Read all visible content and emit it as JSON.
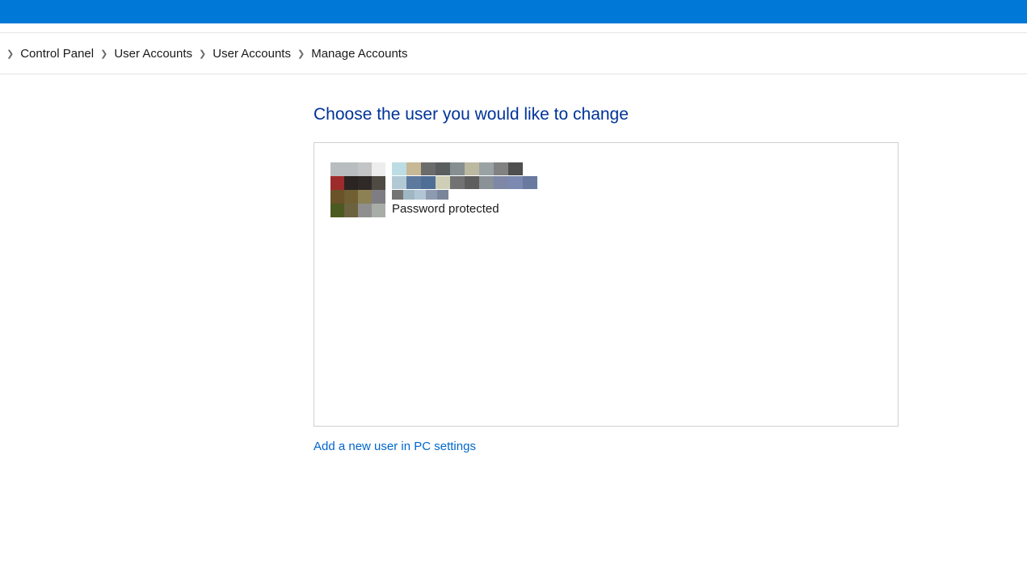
{
  "breadcrumb": {
    "items": [
      "Control Panel",
      "User Accounts",
      "User Accounts",
      "Manage Accounts"
    ]
  },
  "main": {
    "heading": "Choose the user you would like to change",
    "user": {
      "password_status": "Password protected"
    },
    "add_link": "Add a new user in PC settings"
  }
}
